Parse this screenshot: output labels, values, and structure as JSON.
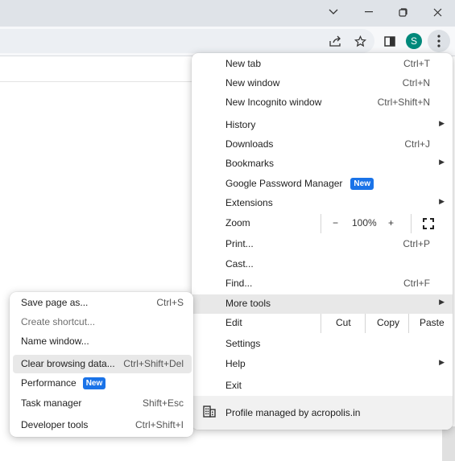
{
  "window_controls": {
    "tab_search_icon": "chevron-down-icon",
    "minimize_icon": "minimize-icon",
    "restore_icon": "restore-icon",
    "close_icon": "close-icon"
  },
  "toolbar": {
    "share_icon": "share-icon",
    "bookmark_icon": "star-icon",
    "side_panel_icon": "side-panel-icon",
    "avatar_letter": "S",
    "avatar_color": "#00897b",
    "menu_icon": "kebab-menu-icon"
  },
  "menu": {
    "new_tab": {
      "label": "New tab",
      "shortcut": "Ctrl+T"
    },
    "new_window": {
      "label": "New window",
      "shortcut": "Ctrl+N"
    },
    "new_incognito": {
      "label": "New Incognito window",
      "shortcut": "Ctrl+Shift+N"
    },
    "history": {
      "label": "History"
    },
    "downloads": {
      "label": "Downloads",
      "shortcut": "Ctrl+J"
    },
    "bookmarks": {
      "label": "Bookmarks"
    },
    "password_manager": {
      "label": "Google Password Manager",
      "badge": "New"
    },
    "extensions": {
      "label": "Extensions"
    },
    "zoom": {
      "label": "Zoom",
      "minus": "−",
      "value": "100%",
      "plus": "+"
    },
    "print": {
      "label": "Print...",
      "shortcut": "Ctrl+P"
    },
    "cast": {
      "label": "Cast..."
    },
    "find": {
      "label": "Find...",
      "shortcut": "Ctrl+F"
    },
    "more_tools": {
      "label": "More tools"
    },
    "edit": {
      "label": "Edit",
      "cut": "Cut",
      "copy": "Copy",
      "paste": "Paste"
    },
    "settings": {
      "label": "Settings"
    },
    "help": {
      "label": "Help"
    },
    "exit": {
      "label": "Exit"
    },
    "managed": {
      "label": "Profile managed by acropolis.in"
    }
  },
  "submenu": {
    "save_page": {
      "label": "Save page as...",
      "shortcut": "Ctrl+S"
    },
    "create_shortcut": {
      "label": "Create shortcut..."
    },
    "name_window": {
      "label": "Name window..."
    },
    "clear_browsing": {
      "label": "Clear browsing data...",
      "shortcut": "Ctrl+Shift+Del"
    },
    "performance": {
      "label": "Performance",
      "badge": "New"
    },
    "task_manager": {
      "label": "Task manager",
      "shortcut": "Shift+Esc"
    },
    "developer_tools": {
      "label": "Developer tools",
      "shortcut": "Ctrl+Shift+I"
    }
  },
  "colors": {
    "accent": "#1a73e8",
    "highlight": "#e8e8e8",
    "titlebar": "#dfe3e8"
  }
}
